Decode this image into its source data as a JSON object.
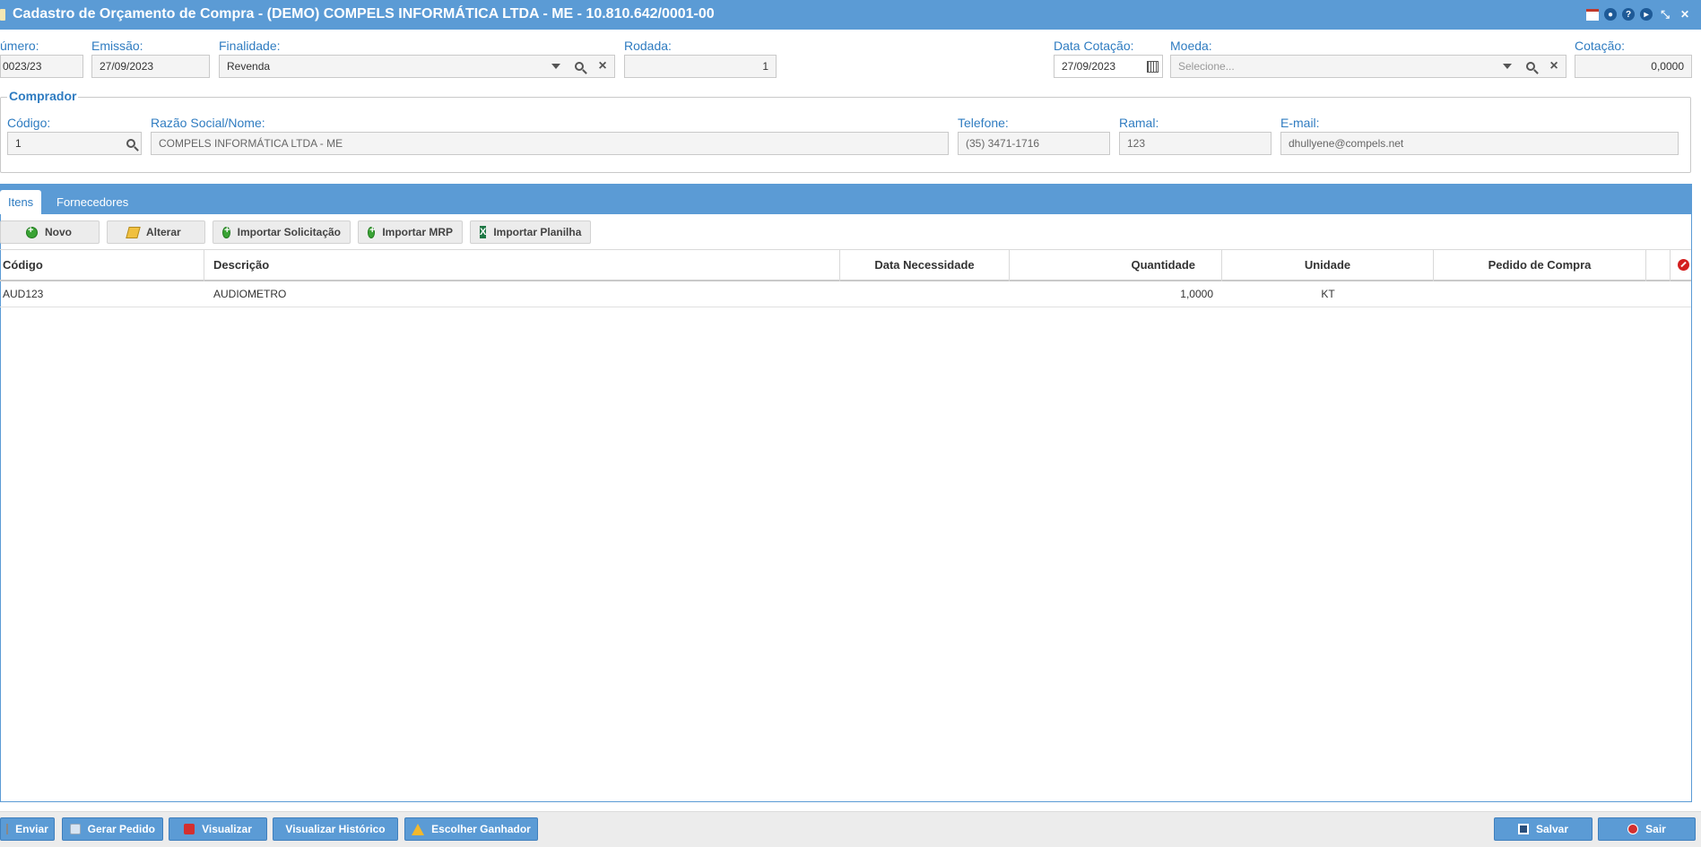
{
  "window": {
    "title": "Cadastro de Orçamento de Compra - (DEMO) COMPELS INFORMÁTICA LTDA - ME - 10.810.642/0001-00"
  },
  "header": {
    "numero_label": "úmero:",
    "numero_value": "0023/23",
    "emissao_label": "Emissão:",
    "emissao_value": "27/09/2023",
    "finalidade_label": "Finalidade:",
    "finalidade_value": "Revenda",
    "rodada_label": "Rodada:",
    "rodada_value": "1",
    "data_cotacao_label": "Data Cotação:",
    "data_cotacao_value": "27/09/2023",
    "moeda_label": "Moeda:",
    "moeda_placeholder": "Selecione...",
    "cotacao_label": "Cotação:",
    "cotacao_value": "0,0000"
  },
  "comprador": {
    "legend": "Comprador",
    "codigo_label": "Código:",
    "codigo_value": "1",
    "razao_label": "Razão Social/Nome:",
    "razao_value": "COMPELS INFORMÁTICA LTDA - ME",
    "telefone_label": "Telefone:",
    "telefone_value": "(35) 3471-1716",
    "ramal_label": "Ramal:",
    "ramal_value": "123",
    "email_label": "E-mail:",
    "email_value": "dhullyene@compels.net"
  },
  "tabs": [
    {
      "label": "Itens",
      "active": true
    },
    {
      "label": "Fornecedores",
      "active": false
    }
  ],
  "toolbar": {
    "novo": "Novo",
    "alterar": "Alterar",
    "importar_solicitacao": "Importar Solicitação",
    "importar_mrp": "Importar MRP",
    "importar_planilha": "Importar Planilha"
  },
  "grid": {
    "columns": [
      "Código",
      "Descrição",
      "Data Necessidade",
      "Quantidade",
      "Unidade",
      "Pedido de Compra"
    ],
    "rows": [
      {
        "codigo": "AUD123",
        "descricao": "AUDIOMETRO",
        "data_necessidade": "",
        "quantidade": "1,0000",
        "unidade": "KT",
        "pedido_compra": ""
      }
    ]
  },
  "footer": {
    "enviar": "Enviar",
    "gerar_pedido": "Gerar Pedido",
    "visualizar": "Visualizar",
    "visualizar_historico": "Visualizar Histórico",
    "escolher_ganhador": "Escolher Ganhador",
    "salvar": "Salvar",
    "sair": "Sair"
  },
  "colors": {
    "accent": "#5b9bd5",
    "label": "#2f7cc1"
  }
}
